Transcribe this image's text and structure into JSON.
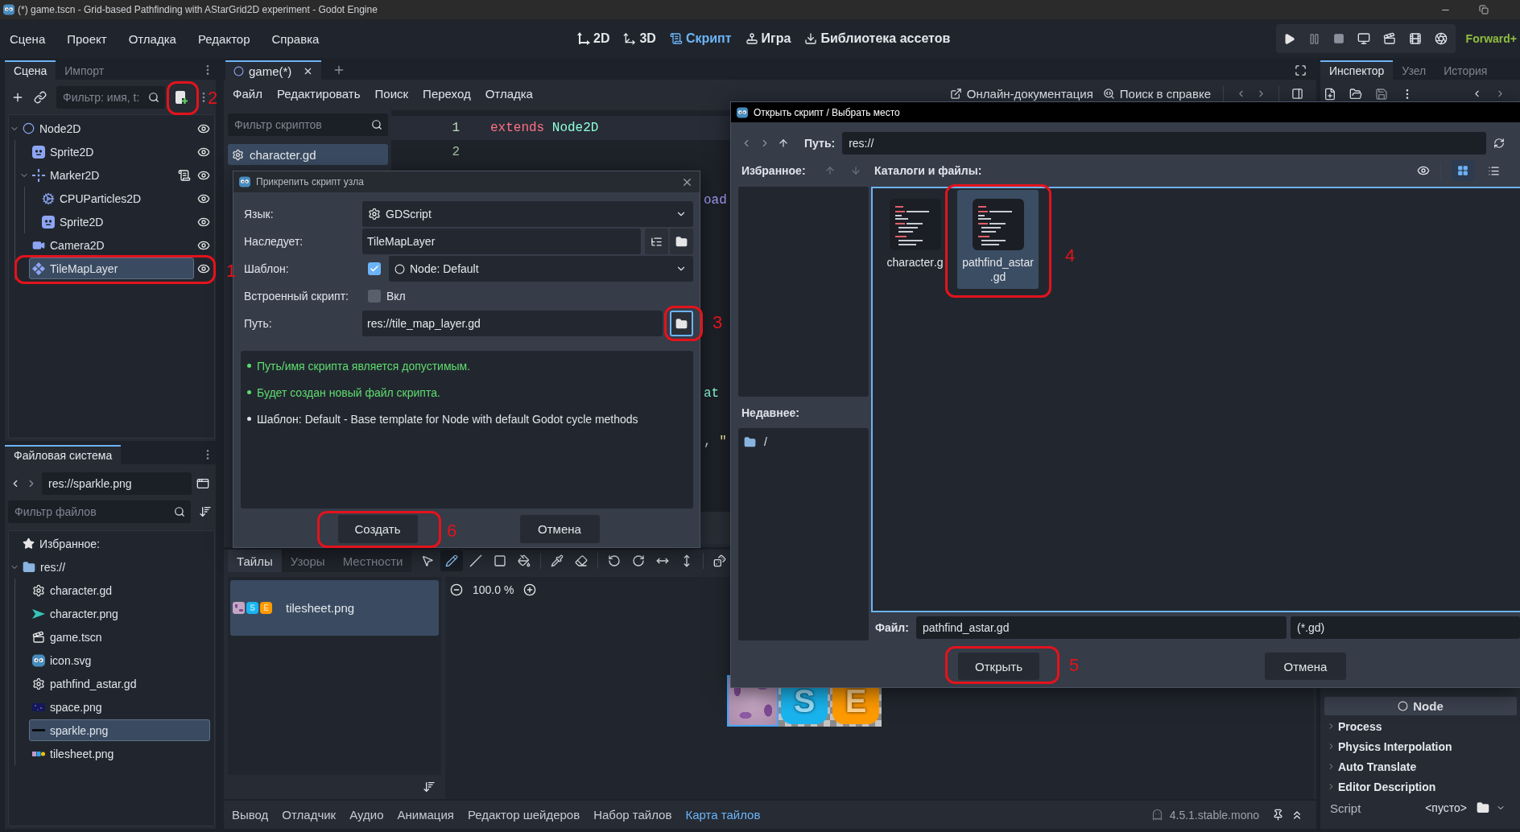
{
  "window": {
    "title": "(*) game.tscn - Grid-based Pathfinding with AStarGrid2D experiment - Godot Engine"
  },
  "menu": [
    "Сцена",
    "Проект",
    "Отладка",
    "Редактор",
    "Справка"
  ],
  "workspaces": [
    {
      "label": "2D",
      "kind": "canvas",
      "selected": false
    },
    {
      "label": "3D",
      "kind": "spatial",
      "selected": false
    },
    {
      "label": "Скрипт",
      "kind": "script",
      "selected": true
    },
    {
      "label": "Игра",
      "kind": "game",
      "selected": false
    },
    {
      "label": "Библиотека ассетов",
      "kind": "assetlib",
      "selected": false
    }
  ],
  "renderer": "Forward+",
  "scene_dock": {
    "tabs": [
      {
        "label": "Сцена",
        "selected": true
      },
      {
        "label": "Импорт",
        "selected": false
      }
    ],
    "filter": {
      "placeholder": "Фильтр: имя, t:"
    },
    "tree": [
      {
        "name": "Node2D",
        "kind": "node2d",
        "expanded": true,
        "selected": false,
        "visible": true,
        "has_script": false,
        "children": [
          {
            "name": "Sprite2D",
            "kind": "sprite",
            "selected": false,
            "visible": true,
            "has_script": false
          },
          {
            "name": "Marker2D",
            "kind": "marker",
            "expanded": true,
            "selected": false,
            "visible": true,
            "has_script": true,
            "children": [
              {
                "name": "CPUParticles2D",
                "kind": "particles",
                "selected": false,
                "visible": true,
                "has_script": false
              },
              {
                "name": "Sprite2D",
                "kind": "sprite",
                "selected": false,
                "visible": true,
                "has_script": false
              }
            ]
          },
          {
            "name": "Camera2D",
            "kind": "camera",
            "selected": false,
            "visible": true,
            "has_script": false
          },
          {
            "name": "TileMapLayer",
            "kind": "tilemap",
            "selected": true,
            "visible": true,
            "has_script": false
          }
        ]
      }
    ]
  },
  "filesystem_dock": {
    "tabs": [
      {
        "label": "Файловая система",
        "selected": true
      }
    ],
    "path": "res://sparkle.png",
    "filter": {
      "placeholder": "Фильтр файлов"
    },
    "tree": [
      {
        "name": "Избранное:",
        "kind": "favorites",
        "selected": false
      },
      {
        "name": "res://",
        "kind": "folder",
        "expanded": true,
        "selected": false,
        "children": [
          {
            "name": "character.gd",
            "kind": "script",
            "selected": false
          },
          {
            "name": "character.png",
            "kind": "sprite",
            "selected": false
          },
          {
            "name": "game.tscn",
            "kind": "scene",
            "selected": false
          },
          {
            "name": "icon.svg",
            "kind": "logo",
            "selected": false
          },
          {
            "name": "pathfind_astar.gd",
            "kind": "script",
            "selected": false
          },
          {
            "name": "space.png",
            "kind": "space",
            "selected": false
          },
          {
            "name": "sparkle.png",
            "kind": "sparkle",
            "selected": true
          },
          {
            "name": "tilesheet.png",
            "kind": "tilesheet",
            "selected": false
          }
        ]
      }
    ]
  },
  "script_editor": {
    "tabs": [
      {
        "label": "game(*)",
        "selected": true
      }
    ],
    "menu": [
      "Файл",
      "Редактировать",
      "Поиск",
      "Переход",
      "Отладка"
    ],
    "help": [
      {
        "label": "Онлайн-документация",
        "kind": "docs"
      },
      {
        "label": "Поиск в справке",
        "kind": "search"
      }
    ],
    "script_filter": {
      "placeholder": "Фильтр скриптов"
    },
    "scripts": [
      {
        "name": "character.gd",
        "selected": true
      }
    ],
    "code_lines": [
      {
        "number": "1",
        "current": true,
        "tokens": [
          {
            "text": "extends",
            "kind": "keyword"
          },
          {
            "text": "Node2D",
            "kind": "type"
          }
        ]
      },
      {
        "number": "2",
        "current": false
      }
    ],
    "code_fragments": [
      {
        "tokens": [
          {
            "text": "oad",
            "kind": "function"
          }
        ]
      },
      {
        "tokens": [
          {
            "text": "at",
            "kind": "type"
          }
        ]
      },
      {
        "tokens": [
          {
            "text": ",",
            "kind": "plain"
          },
          {
            "text": "\"",
            "kind": "string"
          }
        ]
      }
    ]
  },
  "tilemap_panel": {
    "tabs": [
      {
        "label": "Тайлы",
        "selected": true
      },
      {
        "label": "Узоры",
        "selected": false
      },
      {
        "label": "Местности",
        "selected": false
      }
    ],
    "tools": [
      {
        "kind": "select",
        "selected": false
      },
      {
        "kind": "paint",
        "selected": true
      },
      {
        "kind": "line",
        "selected": false
      },
      {
        "kind": "rect",
        "selected": false
      },
      {
        "kind": "fill",
        "selected": false
      },
      {
        "kind": "picker",
        "selected": false
      },
      {
        "kind": "eraser",
        "selected": false
      },
      {
        "kind": "rotate_left",
        "selected": false
      },
      {
        "kind": "rotate_right",
        "selected": false
      },
      {
        "kind": "flip_h",
        "selected": false
      },
      {
        "kind": "flip_v",
        "selected": false
      },
      {
        "kind": "random",
        "selected": false
      }
    ],
    "sources": [
      {
        "name": "tilesheet.png",
        "selected": true,
        "thumbs": [
          {
            "kind": "texture"
          },
          {
            "kind": "letter",
            "label": "S",
            "color": "#19b4ef"
          },
          {
            "kind": "letter",
            "label": "E",
            "color": "#ff9a00"
          }
        ]
      }
    ],
    "zoom": "100.0 %",
    "tiles": [
      {
        "kind": "texture",
        "selected": true
      },
      {
        "kind": "letter",
        "label": "S",
        "color": "#19b4ef",
        "selected": false
      },
      {
        "kind": "letter",
        "label": "E",
        "color": "#ff9a00",
        "selected": false
      }
    ]
  },
  "bottom_tabs": [
    {
      "label": "Вывод",
      "selected": false
    },
    {
      "label": "Отладчик",
      "selected": false
    },
    {
      "label": "Аудио",
      "selected": false
    },
    {
      "label": "Анимация",
      "selected": false
    },
    {
      "label": "Редактор шейдеров",
      "selected": false
    },
    {
      "label": "Набор тайлов",
      "selected": false
    },
    {
      "label": "Карта тайлов",
      "selected": true
    }
  ],
  "version": "4.5.1.stable.mono",
  "inspector": {
    "tabs": [
      {
        "label": "Инспектор",
        "selected": true
      },
      {
        "label": "Узел",
        "selected": false
      },
      {
        "label": "История",
        "selected": false
      }
    ],
    "section": "Node",
    "groups": [
      {
        "label": "Process",
        "expanded": false
      },
      {
        "label": "Physics Interpolation",
        "expanded": false
      },
      {
        "label": "Auto Translate",
        "expanded": false
      },
      {
        "label": "Editor Description",
        "expanded": false
      }
    ],
    "property": {
      "name": "Script",
      "value": "<пусто>"
    }
  },
  "attach_dialog": {
    "title": "Прикрепить скрипт узла",
    "rows": [
      {
        "kind": "language",
        "label": "Язык:",
        "value": "GDScript"
      },
      {
        "kind": "inherits",
        "label": "Наследует:",
        "value": "TileMapLayer"
      },
      {
        "kind": "template",
        "label": "Шаблон:",
        "checked": true,
        "value": "Node: Default"
      },
      {
        "kind": "toggle",
        "label": "Встроенный скрипт:",
        "checked": false,
        "text": "Вкл"
      },
      {
        "kind": "path",
        "label": "Путь:",
        "value": "res://tile_map_layer.gd",
        "focused": true
      }
    ],
    "messages": [
      {
        "text": "Путь/имя скрипта является допустимым.",
        "kind": "ok"
      },
      {
        "text": "Будет создан новый файл скрипта.",
        "kind": "ok"
      },
      {
        "text": "Шаблон: Default - Base template for Node with default Godot cycle methods",
        "kind": "info"
      }
    ],
    "buttons": [
      "Создать",
      "Отмена"
    ]
  },
  "file_dialog": {
    "title": "Открыть скрипт / Выбрать место",
    "path_label": "Путь:",
    "path": "res://",
    "favorites_label": "Избранное:",
    "files_label": "Каталоги и файлы:",
    "view_modes": [
      {
        "kind": "grid",
        "selected": true
      },
      {
        "kind": "list",
        "selected": false
      }
    ],
    "recent_label": "Недавнее:",
    "recent": [
      {
        "name": "/",
        "selected": false
      }
    ],
    "files": [
      {
        "name": "character.g",
        "selected": false
      },
      {
        "name": "pathfind_astar.gd",
        "selected": true
      }
    ],
    "file_label": "Файл:",
    "file_name": "pathfind_astar.gd",
    "filter": "(*.gd)",
    "buttons": [
      "Открыть",
      "Отмена"
    ]
  },
  "annotations": [
    {
      "label": "1"
    },
    {
      "label": "2"
    },
    {
      "label": "3"
    },
    {
      "label": "4"
    },
    {
      "label": "5"
    },
    {
      "label": "6"
    }
  ]
}
